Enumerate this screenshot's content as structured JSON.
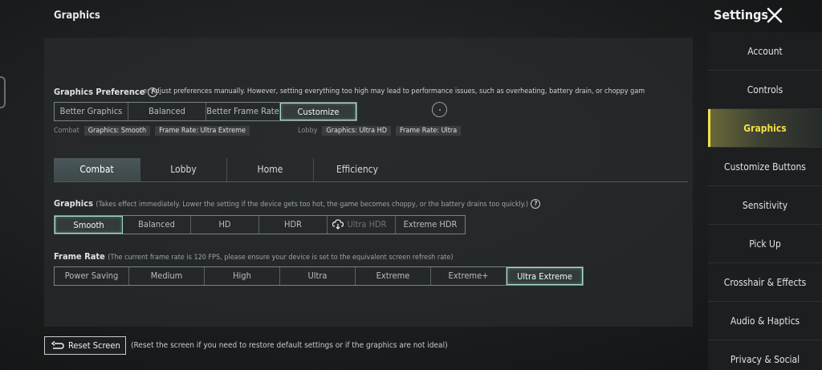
{
  "header": {
    "section_title": "Graphics",
    "settings_title": "Settings"
  },
  "preference": {
    "label": "Graphics Preference",
    "help": "?",
    "description": "e: Adjust preferences manually. However, setting everything too high may lead to performance issues, such as overheating, battery drain, or choppy gam",
    "options": [
      "Better Graphics",
      "Balanced",
      "Better Frame Rate",
      "Customize"
    ],
    "selected": "Customize"
  },
  "summary": {
    "combat_label": "Combat",
    "combat_graphics": "Graphics: Smooth",
    "combat_framerate": "Frame Rate: Ultra Extreme",
    "lobby_label": "Lobby",
    "lobby_graphics": "Graphics: Ultra HD",
    "lobby_framerate": "Frame Rate: Ultra"
  },
  "tabs": [
    "Combat",
    "Lobby",
    "Home",
    "Efficiency"
  ],
  "active_tab": "Combat",
  "graphics": {
    "label": "Graphics",
    "hint": "(Takes effect immediately. Lower the setting if the device gets too hot, the game becomes choppy, or the battery drains too quickly.)",
    "options": [
      "Smooth",
      "Balanced",
      "HD",
      "HDR",
      "Ultra HDR",
      "Extreme HDR"
    ],
    "selected": "Smooth"
  },
  "framerate": {
    "label": "Frame Rate",
    "hint": "(The current frame rate is 120 FPS, please ensure your device is set to the equivalent screen refresh rate)",
    "options": [
      "Power Saving",
      "Medium",
      "High",
      "Ultra",
      "Extreme",
      "Extreme+",
      "Ultra Extreme"
    ],
    "selected": "Ultra Extreme"
  },
  "footer": {
    "reset_label": "Reset Screen",
    "reset_hint": "(Reset the screen if you need to restore default settings or if the graphics are not ideal)"
  },
  "sidebar": {
    "items": [
      "Account",
      "Controls",
      "Graphics",
      "Customize Buttons",
      "Sensitivity",
      "Pick Up",
      "Crosshair & Effects",
      "Audio & Haptics",
      "Privacy & Social"
    ],
    "active": "Graphics"
  },
  "colors": {
    "accent_selected": "#9fe0c8",
    "sidebar_active": "#f3e14a"
  },
  "icons": {
    "close": "close-icon",
    "help": "help-icon",
    "reset": "reset-arrow-icon",
    "cloud": "cloud-download-icon"
  }
}
